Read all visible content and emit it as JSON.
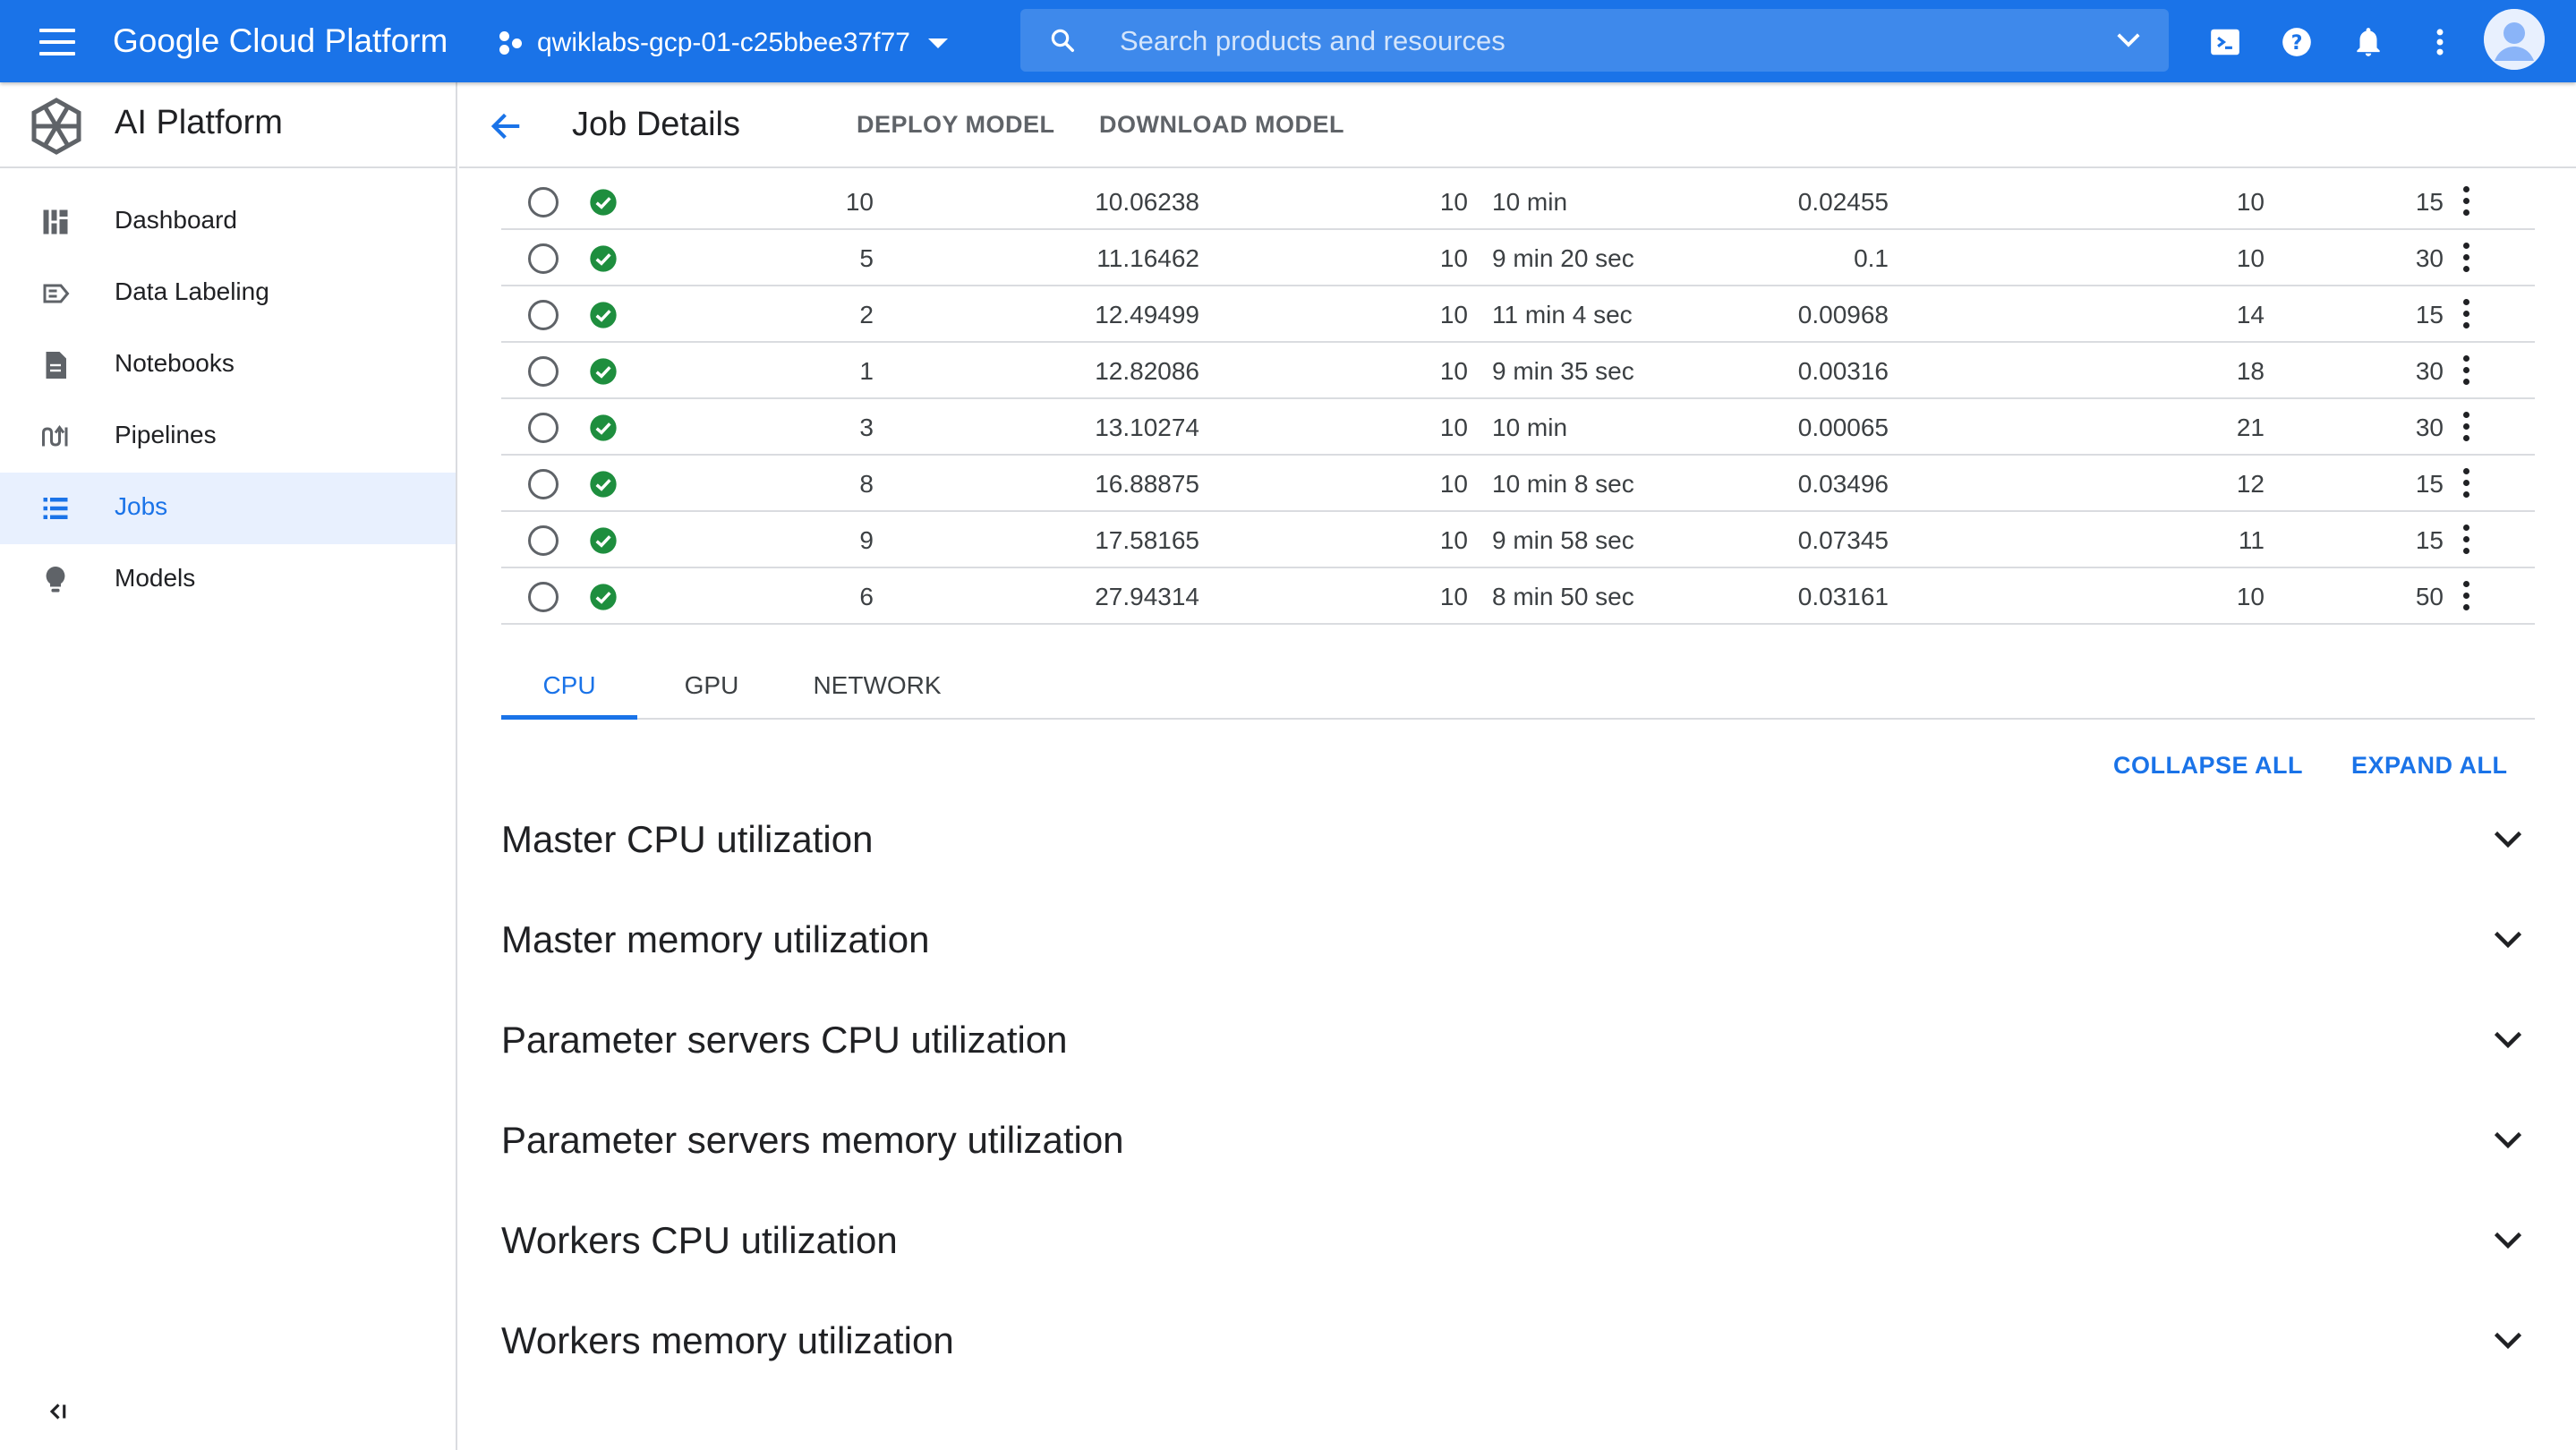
{
  "topbar": {
    "brand": "Google Cloud Platform",
    "project": "qwiklabs-gcp-01-c25bbee37f77",
    "search_placeholder": "Search products and resources",
    "accent": "#1a73e8"
  },
  "sidebar": {
    "title": "AI Platform",
    "items": [
      {
        "label": "Dashboard",
        "icon": "dashboard-icon"
      },
      {
        "label": "Data Labeling",
        "icon": "data-labeling-icon"
      },
      {
        "label": "Notebooks",
        "icon": "notebook-icon"
      },
      {
        "label": "Pipelines",
        "icon": "pipelines-icon"
      },
      {
        "label": "Jobs",
        "icon": "list-icon",
        "active": true
      },
      {
        "label": "Models",
        "icon": "lightbulb-icon"
      }
    ]
  },
  "header": {
    "title": "Job Details",
    "deploy_label": "DEPLOY MODEL",
    "download_label": "DOWNLOAD MODEL"
  },
  "trials": {
    "rows": [
      {
        "trial": "10",
        "metric": "10.06238",
        "steps": "10",
        "time": "10 min",
        "lr": "0.02455",
        "p1": "10",
        "p2": "15"
      },
      {
        "trial": "5",
        "metric": "11.16462",
        "steps": "10",
        "time": "9 min 20 sec",
        "lr": "0.1",
        "p1": "10",
        "p2": "30"
      },
      {
        "trial": "2",
        "metric": "12.49499",
        "steps": "10",
        "time": "11 min 4 sec",
        "lr": "0.00968",
        "p1": "14",
        "p2": "15"
      },
      {
        "trial": "1",
        "metric": "12.82086",
        "steps": "10",
        "time": "9 min 35 sec",
        "lr": "0.00316",
        "p1": "18",
        "p2": "30"
      },
      {
        "trial": "3",
        "metric": "13.10274",
        "steps": "10",
        "time": "10 min",
        "lr": "0.00065",
        "p1": "21",
        "p2": "30"
      },
      {
        "trial": "8",
        "metric": "16.88875",
        "steps": "10",
        "time": "10 min 8 sec",
        "lr": "0.03496",
        "p1": "12",
        "p2": "15"
      },
      {
        "trial": "9",
        "metric": "17.58165",
        "steps": "10",
        "time": "9 min 58 sec",
        "lr": "0.07345",
        "p1": "11",
        "p2": "15"
      },
      {
        "trial": "6",
        "metric": "27.94314",
        "steps": "10",
        "time": "8 min 50 sec",
        "lr": "0.03161",
        "p1": "10",
        "p2": "50"
      }
    ]
  },
  "tabs": [
    {
      "label": "CPU",
      "active": true
    },
    {
      "label": "GPU"
    },
    {
      "label": "NETWORK"
    }
  ],
  "actions": {
    "collapse_all": "COLLAPSE ALL",
    "expand_all": "EXPAND ALL"
  },
  "sections": [
    {
      "title": "Master CPU utilization"
    },
    {
      "title": "Master memory utilization"
    },
    {
      "title": "Parameter servers CPU utilization"
    },
    {
      "title": "Parameter servers memory utilization"
    },
    {
      "title": "Workers CPU utilization"
    },
    {
      "title": "Workers memory utilization"
    }
  ],
  "colors": {
    "success": "#1e8e3e",
    "border": "#dadce0"
  }
}
